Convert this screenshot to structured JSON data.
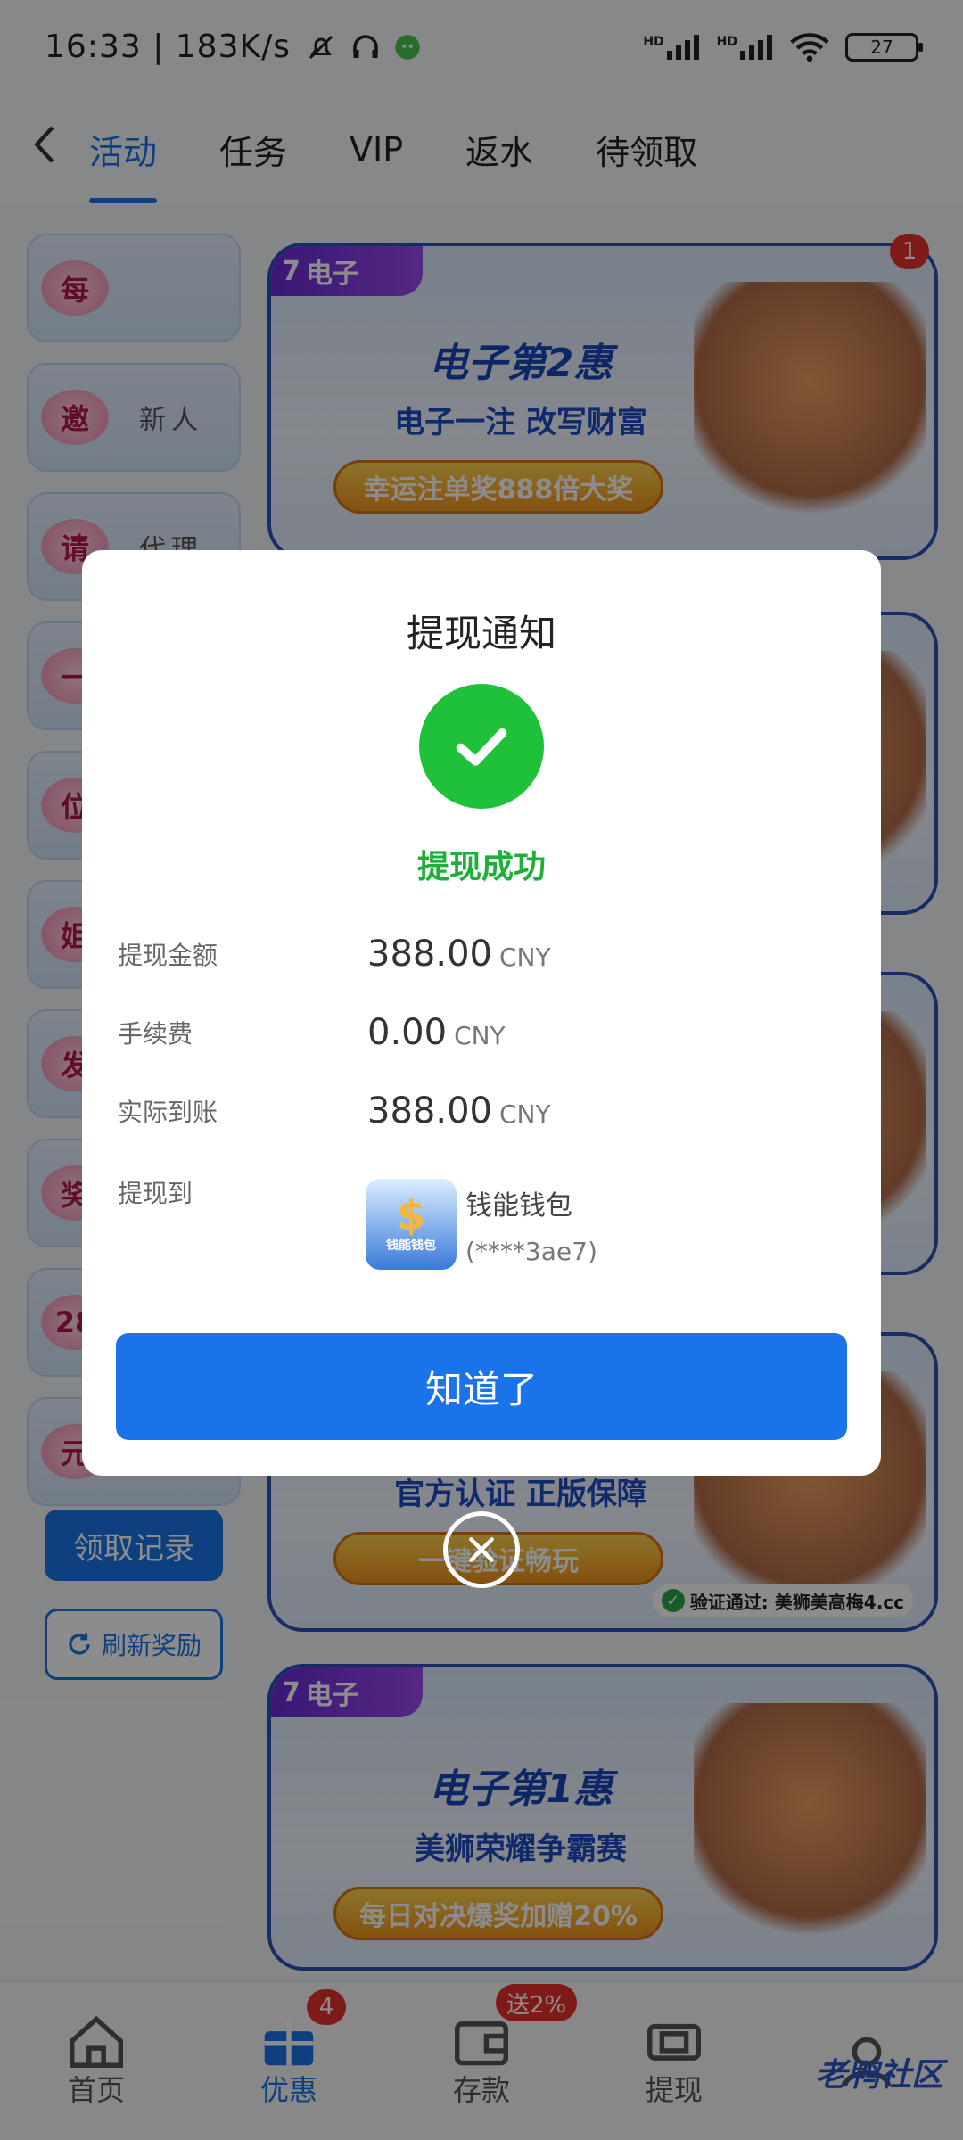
{
  "status_bar": {
    "time": "16:33 | 183K/s",
    "signal1": "HD",
    "signal2": "HD",
    "battery": "27"
  },
  "top_nav": {
    "tabs": [
      "活动",
      "任务",
      "VIP",
      "返水",
      "待领取"
    ]
  },
  "left_menu": {
    "items": [
      {
        "seal": "每",
        "label": ""
      },
      {
        "seal": "邀",
        "label": "新人"
      },
      {
        "seal": "请",
        "label": "代理"
      },
      {
        "seal": "一",
        "label": ""
      },
      {
        "seal": "位",
        "label": ""
      },
      {
        "seal": "姐",
        "label": ""
      },
      {
        "seal": "发",
        "label": ""
      },
      {
        "seal": "奖",
        "label": ""
      },
      {
        "seal": "28",
        "label": ""
      },
      {
        "seal": "元",
        "label": ""
      }
    ],
    "records_button": "领取记录",
    "refresh_button": "刷新奖励"
  },
  "banners": [
    {
      "tag": "电子",
      "title": "电子第2惠",
      "subtitle": "电子一注 改写财富",
      "pill": "幸运注单奖888倍大奖",
      "badge": "1"
    },
    {
      "subtitle": "官方认证 正版保障",
      "pill": "一键验证畅玩",
      "verify": "验证通过: 美狮美高梅4.cc"
    },
    {
      "tag": "电子",
      "title": "电子第1惠",
      "subtitle": "美狮荣耀争霸赛",
      "pill": "每日对决爆奖加赠20%"
    }
  ],
  "bottom_nav": {
    "items": [
      {
        "label": "首页",
        "badge": ""
      },
      {
        "label": "优惠",
        "badge": "4"
      },
      {
        "label": "存款",
        "badge": "送2%"
      },
      {
        "label": "提现",
        "badge": ""
      },
      {
        "label": "",
        "badge": ""
      }
    ],
    "watermark": "老鸭社区"
  },
  "dialog": {
    "title": "提现通知",
    "status": "提现成功",
    "rows": [
      {
        "label": "提现金额",
        "amount": "388.00",
        "currency": "CNY"
      },
      {
        "label": "手续费",
        "amount": "0.00",
        "currency": "CNY"
      },
      {
        "label": "实际到账",
        "amount": "388.00",
        "currency": "CNY"
      }
    ],
    "withdraw_to_label": "提现到",
    "wallet_name": "钱能钱包",
    "wallet_logo_text": "钱能钱包",
    "wallet_account": "(****3ae7)",
    "confirm_button": "知道了"
  },
  "colors": {
    "primary": "#1a73e8",
    "success": "#1fc13a",
    "badge": "#e6322c"
  }
}
